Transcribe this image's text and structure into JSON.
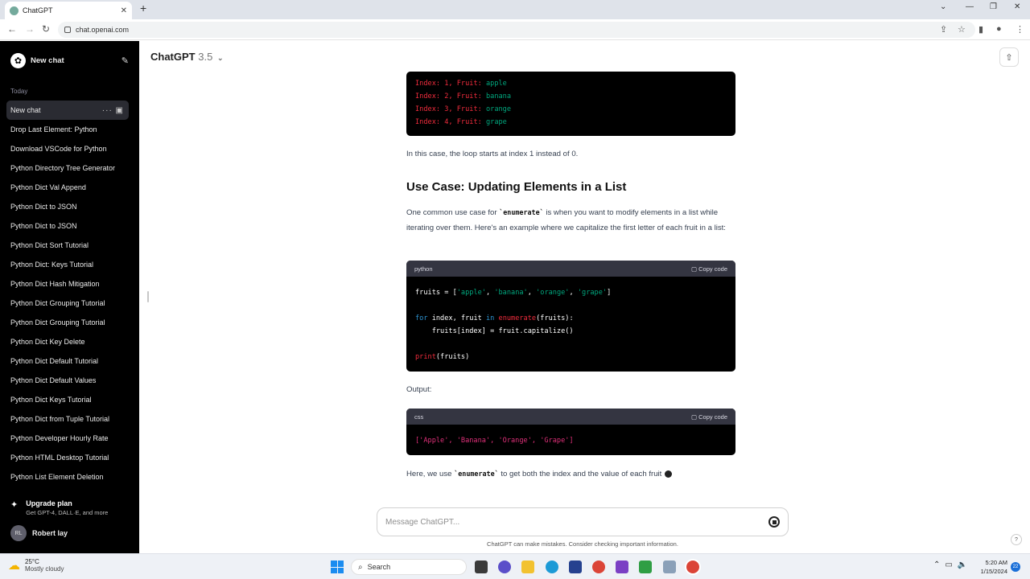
{
  "browser": {
    "tab_title": "ChatGPT",
    "url": "chat.openai.com"
  },
  "sidebar": {
    "new_chat_label": "New chat",
    "section_today": "Today",
    "items": [
      {
        "label": "New chat"
      },
      {
        "label": "Drop Last Element: Python"
      },
      {
        "label": "Download VSCode for Python"
      },
      {
        "label": "Python Directory Tree Generator"
      },
      {
        "label": "Python Dict Val Append"
      },
      {
        "label": "Python Dict to JSON"
      },
      {
        "label": "Python Dict to JSON"
      },
      {
        "label": "Python Dict Sort Tutorial"
      },
      {
        "label": "Python Dict: Keys Tutorial"
      },
      {
        "label": "Python Dict Hash Mitigation"
      },
      {
        "label": "Python Dict Grouping Tutorial"
      },
      {
        "label": "Python Dict Grouping Tutorial"
      },
      {
        "label": "Python Dict Key Delete"
      },
      {
        "label": "Python Dict Default Tutorial"
      },
      {
        "label": "Python Dict Default Values"
      },
      {
        "label": "Python Dict Keys Tutorial"
      },
      {
        "label": "Python Dict from Tuple Tutorial"
      },
      {
        "label": "Python Developer Hourly Rate"
      },
      {
        "label": "Python HTML Desktop Tutorial"
      },
      {
        "label": "Python List Element Deletion"
      }
    ],
    "upgrade_title": "Upgrade plan",
    "upgrade_sub": "Get GPT-4, DALL·E, and more",
    "user_initials": "RL",
    "user_name": "Robert lay"
  },
  "header": {
    "model_name": "ChatGPT",
    "model_version": "3.5"
  },
  "content": {
    "output1_lines": [
      {
        "idx": "1",
        "fruit": "apple"
      },
      {
        "idx": "2",
        "fruit": "banana"
      },
      {
        "idx": "3",
        "fruit": "orange"
      },
      {
        "idx": "4",
        "fruit": "grape"
      }
    ],
    "loop_note": "In this case, the loop starts at index 1 instead of 0.",
    "heading": "Use Case: Updating Elements in a List",
    "para_a": "One common use case for ",
    "para_code": "`enumerate`",
    "para_b": " is when you want to modify elements in a list while iterating over them. Here's an example where we capitalize the first letter of each fruit in a list:",
    "code_lang": "python",
    "copy_label": "Copy code",
    "output_label": "Output:",
    "css_lang": "css",
    "css_output": "['Apple', 'Banana', 'Orange', 'Grape']",
    "final_a": "Here, we use ",
    "final_code": "`enumerate`",
    "final_b": " to get both the index and the value of each fruit"
  },
  "composer": {
    "placeholder": "Message ChatGPT..."
  },
  "disclaimer": "ChatGPT can make mistakes. Consider checking important information.",
  "taskbar": {
    "temp": "25°C",
    "condition": "Mostly cloudy",
    "search_label": "Search",
    "time": "5:20 AM",
    "date": "1/15/2024",
    "notif_count": "22"
  }
}
